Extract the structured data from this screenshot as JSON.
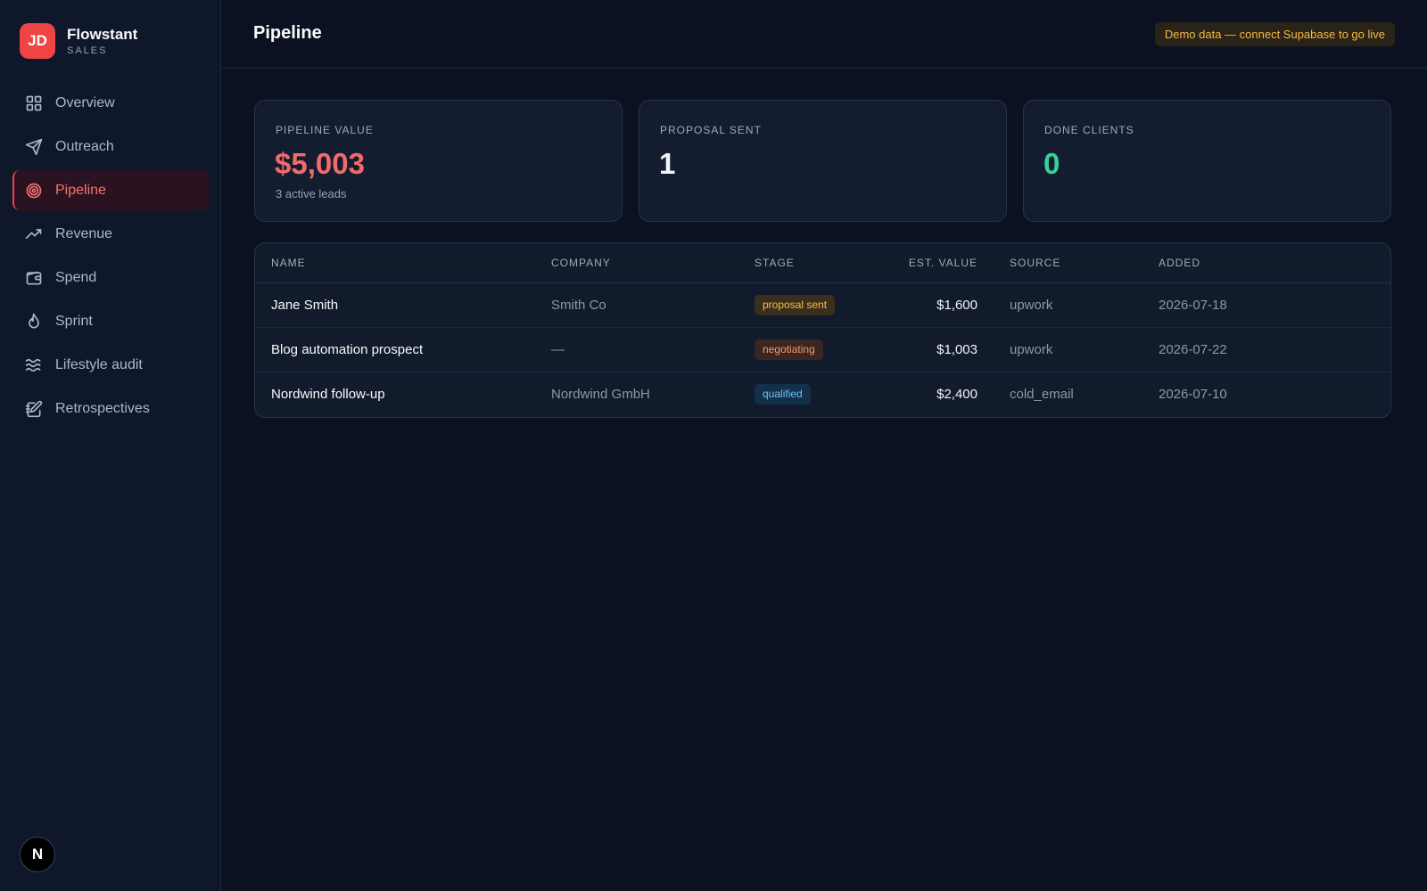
{
  "brand": {
    "initials": "JD",
    "name": "Flowstant",
    "subtitle": "SALES"
  },
  "sidebar": {
    "items": [
      {
        "label": "Overview",
        "icon": "grid-icon",
        "active": false
      },
      {
        "label": "Outreach",
        "icon": "send-icon",
        "active": false
      },
      {
        "label": "Pipeline",
        "icon": "target-icon",
        "active": true
      },
      {
        "label": "Revenue",
        "icon": "trending-up-icon",
        "active": false
      },
      {
        "label": "Spend",
        "icon": "wallet-icon",
        "active": false
      },
      {
        "label": "Sprint",
        "icon": "flame-icon",
        "active": false
      },
      {
        "label": "Lifestyle audit",
        "icon": "waves-icon",
        "active": false
      },
      {
        "label": "Retrospectives",
        "icon": "notebook-pen-icon",
        "active": false
      }
    ],
    "bottom_logo": "N"
  },
  "header": {
    "title": "Pipeline",
    "demo_badge": "Demo data — connect Supabase to go live"
  },
  "cards": [
    {
      "label": "PIPELINE VALUE",
      "value": "$5,003",
      "sub": "3 active leads",
      "color": "#f06b6b"
    },
    {
      "label": "PROPOSAL SENT",
      "value": "1",
      "sub": "",
      "color": "#f1f5f9"
    },
    {
      "label": "DONE CLIENTS",
      "value": "0",
      "sub": "",
      "color": "#34d399"
    }
  ],
  "table": {
    "columns": [
      "NAME",
      "COMPANY",
      "STAGE",
      "EST. VALUE",
      "SOURCE",
      "ADDED"
    ],
    "rows": [
      {
        "name": "Jane Smith",
        "company": "Smith Co",
        "stage": "proposal sent",
        "value": "$1,600",
        "source": "upwork",
        "added": "2026-07-18"
      },
      {
        "name": "Blog automation prospect",
        "company": "—",
        "stage": "negotiating",
        "value": "$1,003",
        "source": "upwork",
        "added": "2026-07-22"
      },
      {
        "name": "Nordwind follow-up",
        "company": "Nordwind GmbH",
        "stage": "qualified",
        "value": "$2,400",
        "source": "cold_email",
        "added": "2026-07-10"
      }
    ]
  },
  "stage_colors": {
    "proposal sent": {
      "bg": "#3a2e1c",
      "fg": "#f5c04a"
    },
    "negotiating": {
      "bg": "#3a2520",
      "fg": "#f59a6a"
    },
    "qualified": {
      "bg": "#12304a",
      "fg": "#6cc4f2"
    }
  }
}
